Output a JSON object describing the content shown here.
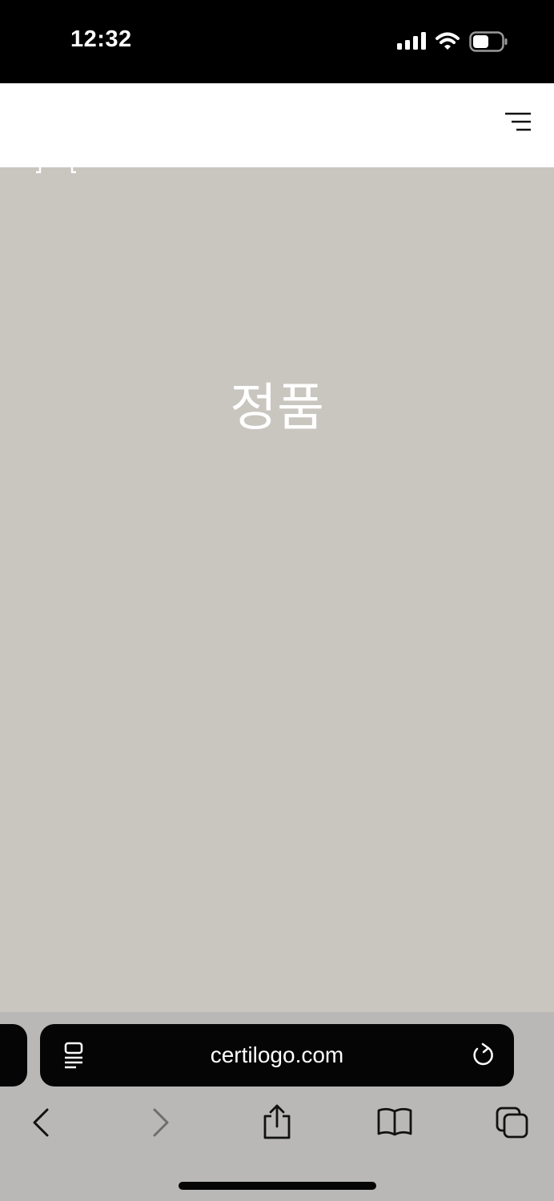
{
  "status_bar": {
    "time": "12:32",
    "icons": [
      "signal-icon",
      "wifi-icon",
      "battery-icon"
    ]
  },
  "header": {
    "logo_icon": "bracket-logo-icon",
    "menu_icon": "hamburger-menu-icon"
  },
  "hero": {
    "title": "정품",
    "background_color": "#c9c6c0"
  },
  "browser": {
    "url": "certilogo.com",
    "reader_icon": "reader-mode-icon",
    "reload_icon": "reload-icon",
    "toolbar_icons": [
      "back-icon",
      "forward-icon",
      "share-icon",
      "bookmarks-icon",
      "tabs-icon"
    ]
  }
}
